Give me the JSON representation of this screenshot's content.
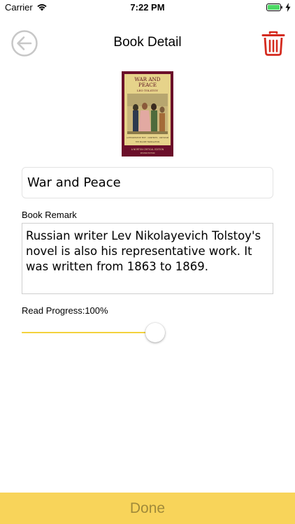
{
  "status_bar": {
    "carrier": "Carrier",
    "time": "7:22 PM",
    "battery_color": "#4cd964"
  },
  "nav": {
    "title": "Book Detail",
    "back_icon": "back-arrow-circle-icon",
    "delete_icon": "trash-icon",
    "delete_color": "#d42a1e",
    "back_color": "#c7c7c7"
  },
  "book": {
    "cover_title": "WAR AND PEACE",
    "cover_author": "LEO TOLSTOY",
    "cover_edition": "A NORTON CRITICAL EDITION",
    "title_value": "War and Peace",
    "remark_label": "Book Remark",
    "remark_text": "Russian writer Lev Nikolayevich Tolstoy's novel is also his representative work. It was written from 1863 to 1869.",
    "progress_label": "Read Progress:100%",
    "progress": 1.0
  },
  "footer": {
    "done_label": "Done",
    "bar_color": "#f8d45a"
  }
}
